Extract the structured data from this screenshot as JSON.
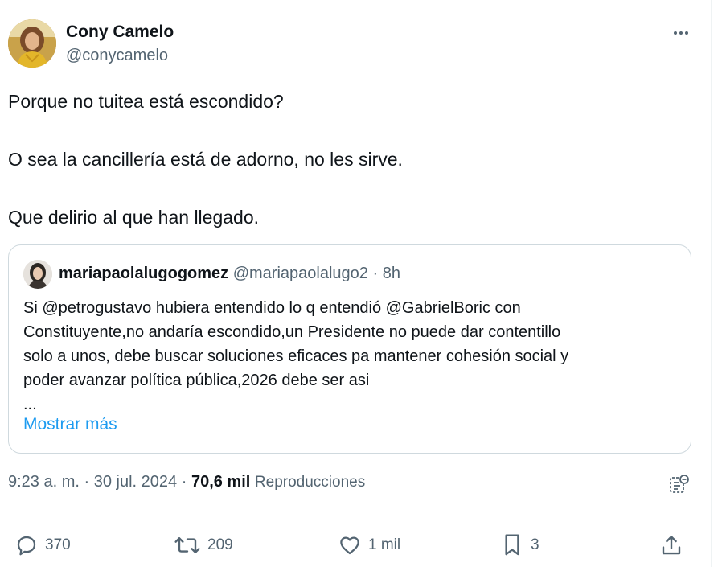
{
  "author": {
    "name": "Cony Camelo",
    "handle": "@conycamelo"
  },
  "tweet": {
    "lines": [
      "Porque no tuitea está escondido?",
      "O sea la cancillería está de adorno, no les sirve.",
      "Que delirio al que han llegado."
    ]
  },
  "quote": {
    "name": "mariapaolalugogomez",
    "handle": "@mariapaolalugo2",
    "separator": "·",
    "time": "8h",
    "lines": [
      "Si @petrogustavo hubiera entendido lo q entendió @GabrielBoric con",
      "Constituyente,no andaría escondido,un Presidente no puede dar contentillo",
      "solo a unos, debe buscar soluciones eficaces pa mantener cohesión social y",
      "poder avanzar política pública,2026 debe ser asi",
      "..."
    ],
    "show_more": "Mostrar más"
  },
  "meta": {
    "time": "9:23 a. m.",
    "sep1": "·",
    "date": "30 jul. 2024",
    "sep2": "·",
    "views_count": "70,6 mil",
    "views_label": "Reproducciones"
  },
  "actions": {
    "replies": "370",
    "retweets": "209",
    "likes": "1 mil",
    "bookmarks": "3"
  },
  "icons": {
    "more": "more-icon",
    "analytics": "analytics-icon",
    "reply": "reply-icon",
    "retweet": "retweet-icon",
    "like": "heart-icon",
    "bookmark": "bookmark-icon",
    "share": "share-icon"
  },
  "colors": {
    "text": "#0f1419",
    "secondary": "#536471",
    "link": "#1d9bf0",
    "border": "#cfd9de"
  }
}
